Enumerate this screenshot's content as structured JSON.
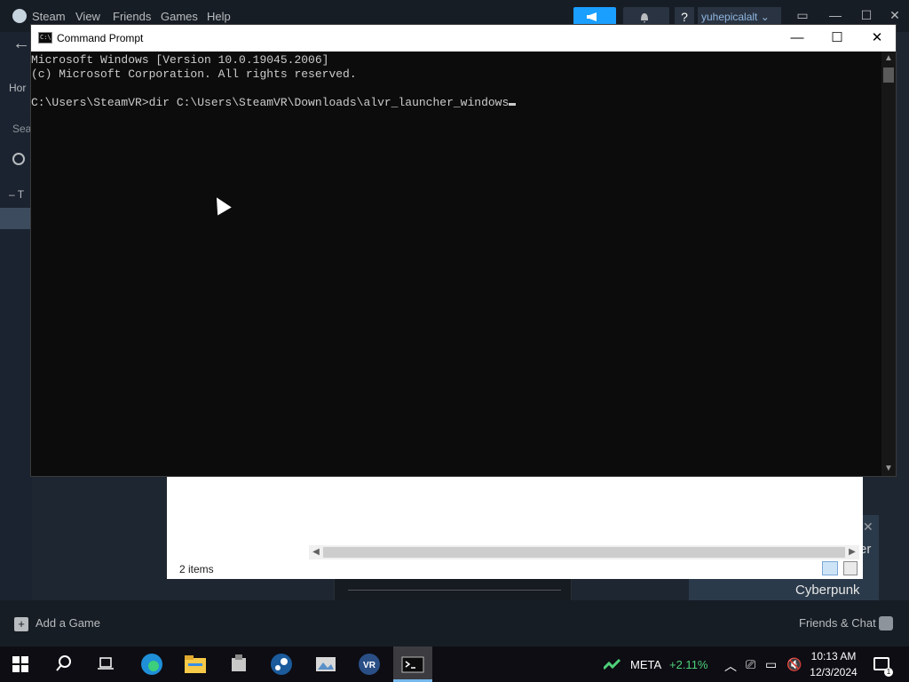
{
  "steam": {
    "menu": [
      "Steam",
      "View",
      "Friends",
      "Games",
      "Help"
    ],
    "help_label": "?",
    "username": "yuhepicalalt",
    "nav_home": "Hor",
    "nav_search": "Sea",
    "nav_collapse": "– T",
    "add_game": "Add a Game",
    "friends_chat": "Friends & Chat",
    "featured_title": "Cyberpunk",
    "featured_partial": "er"
  },
  "explorer": {
    "status": "2 items"
  },
  "cmd": {
    "title": "Command Prompt",
    "lines": [
      "Microsoft Windows [Version 10.0.19045.2006]",
      "(c) Microsoft Corporation. All rights reserved.",
      "",
      "C:\\Users\\SteamVR>dir C:\\Users\\SteamVR\\Downloads\\alvr_launcher_windows"
    ],
    "minimize": "—",
    "maximize": "☐",
    "close": "✕"
  },
  "taskbar": {
    "stock_name": "META",
    "stock_change": "+2.11%",
    "time": "10:13 AM",
    "date": "12/3/2024",
    "notification_count": "1",
    "apps": [
      "edge-icon",
      "file-explorer-icon",
      "package-icon",
      "steam-icon",
      "image-viewer-icon",
      "steamvr-icon",
      "cmd-icon"
    ]
  },
  "colors": {
    "steam_accent": "#1a9fff",
    "stock_up": "#4fd07a",
    "console_bg": "#0c0c0c",
    "console_text": "#cccccc"
  }
}
